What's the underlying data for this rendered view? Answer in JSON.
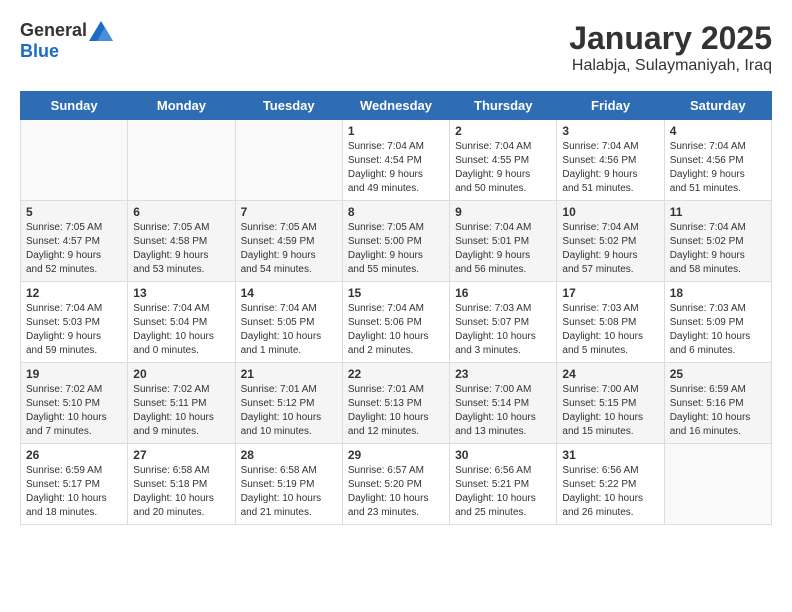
{
  "header": {
    "logo_general": "General",
    "logo_blue": "Blue",
    "month_title": "January 2025",
    "subtitle": "Halabja, Sulaymaniyah, Iraq"
  },
  "weekdays": [
    "Sunday",
    "Monday",
    "Tuesday",
    "Wednesday",
    "Thursday",
    "Friday",
    "Saturday"
  ],
  "weeks": [
    [
      {
        "day": "",
        "info": ""
      },
      {
        "day": "",
        "info": ""
      },
      {
        "day": "",
        "info": ""
      },
      {
        "day": "1",
        "info": "Sunrise: 7:04 AM\nSunset: 4:54 PM\nDaylight: 9 hours\nand 49 minutes."
      },
      {
        "day": "2",
        "info": "Sunrise: 7:04 AM\nSunset: 4:55 PM\nDaylight: 9 hours\nand 50 minutes."
      },
      {
        "day": "3",
        "info": "Sunrise: 7:04 AM\nSunset: 4:56 PM\nDaylight: 9 hours\nand 51 minutes."
      },
      {
        "day": "4",
        "info": "Sunrise: 7:04 AM\nSunset: 4:56 PM\nDaylight: 9 hours\nand 51 minutes."
      }
    ],
    [
      {
        "day": "5",
        "info": "Sunrise: 7:05 AM\nSunset: 4:57 PM\nDaylight: 9 hours\nand 52 minutes."
      },
      {
        "day": "6",
        "info": "Sunrise: 7:05 AM\nSunset: 4:58 PM\nDaylight: 9 hours\nand 53 minutes."
      },
      {
        "day": "7",
        "info": "Sunrise: 7:05 AM\nSunset: 4:59 PM\nDaylight: 9 hours\nand 54 minutes."
      },
      {
        "day": "8",
        "info": "Sunrise: 7:05 AM\nSunset: 5:00 PM\nDaylight: 9 hours\nand 55 minutes."
      },
      {
        "day": "9",
        "info": "Sunrise: 7:04 AM\nSunset: 5:01 PM\nDaylight: 9 hours\nand 56 minutes."
      },
      {
        "day": "10",
        "info": "Sunrise: 7:04 AM\nSunset: 5:02 PM\nDaylight: 9 hours\nand 57 minutes."
      },
      {
        "day": "11",
        "info": "Sunrise: 7:04 AM\nSunset: 5:02 PM\nDaylight: 9 hours\nand 58 minutes."
      }
    ],
    [
      {
        "day": "12",
        "info": "Sunrise: 7:04 AM\nSunset: 5:03 PM\nDaylight: 9 hours\nand 59 minutes."
      },
      {
        "day": "13",
        "info": "Sunrise: 7:04 AM\nSunset: 5:04 PM\nDaylight: 10 hours\nand 0 minutes."
      },
      {
        "day": "14",
        "info": "Sunrise: 7:04 AM\nSunset: 5:05 PM\nDaylight: 10 hours\nand 1 minute."
      },
      {
        "day": "15",
        "info": "Sunrise: 7:04 AM\nSunset: 5:06 PM\nDaylight: 10 hours\nand 2 minutes."
      },
      {
        "day": "16",
        "info": "Sunrise: 7:03 AM\nSunset: 5:07 PM\nDaylight: 10 hours\nand 3 minutes."
      },
      {
        "day": "17",
        "info": "Sunrise: 7:03 AM\nSunset: 5:08 PM\nDaylight: 10 hours\nand 5 minutes."
      },
      {
        "day": "18",
        "info": "Sunrise: 7:03 AM\nSunset: 5:09 PM\nDaylight: 10 hours\nand 6 minutes."
      }
    ],
    [
      {
        "day": "19",
        "info": "Sunrise: 7:02 AM\nSunset: 5:10 PM\nDaylight: 10 hours\nand 7 minutes."
      },
      {
        "day": "20",
        "info": "Sunrise: 7:02 AM\nSunset: 5:11 PM\nDaylight: 10 hours\nand 9 minutes."
      },
      {
        "day": "21",
        "info": "Sunrise: 7:01 AM\nSunset: 5:12 PM\nDaylight: 10 hours\nand 10 minutes."
      },
      {
        "day": "22",
        "info": "Sunrise: 7:01 AM\nSunset: 5:13 PM\nDaylight: 10 hours\nand 12 minutes."
      },
      {
        "day": "23",
        "info": "Sunrise: 7:00 AM\nSunset: 5:14 PM\nDaylight: 10 hours\nand 13 minutes."
      },
      {
        "day": "24",
        "info": "Sunrise: 7:00 AM\nSunset: 5:15 PM\nDaylight: 10 hours\nand 15 minutes."
      },
      {
        "day": "25",
        "info": "Sunrise: 6:59 AM\nSunset: 5:16 PM\nDaylight: 10 hours\nand 16 minutes."
      }
    ],
    [
      {
        "day": "26",
        "info": "Sunrise: 6:59 AM\nSunset: 5:17 PM\nDaylight: 10 hours\nand 18 minutes."
      },
      {
        "day": "27",
        "info": "Sunrise: 6:58 AM\nSunset: 5:18 PM\nDaylight: 10 hours\nand 20 minutes."
      },
      {
        "day": "28",
        "info": "Sunrise: 6:58 AM\nSunset: 5:19 PM\nDaylight: 10 hours\nand 21 minutes."
      },
      {
        "day": "29",
        "info": "Sunrise: 6:57 AM\nSunset: 5:20 PM\nDaylight: 10 hours\nand 23 minutes."
      },
      {
        "day": "30",
        "info": "Sunrise: 6:56 AM\nSunset: 5:21 PM\nDaylight: 10 hours\nand 25 minutes."
      },
      {
        "day": "31",
        "info": "Sunrise: 6:56 AM\nSunset: 5:22 PM\nDaylight: 10 hours\nand 26 minutes."
      },
      {
        "day": "",
        "info": ""
      }
    ]
  ]
}
